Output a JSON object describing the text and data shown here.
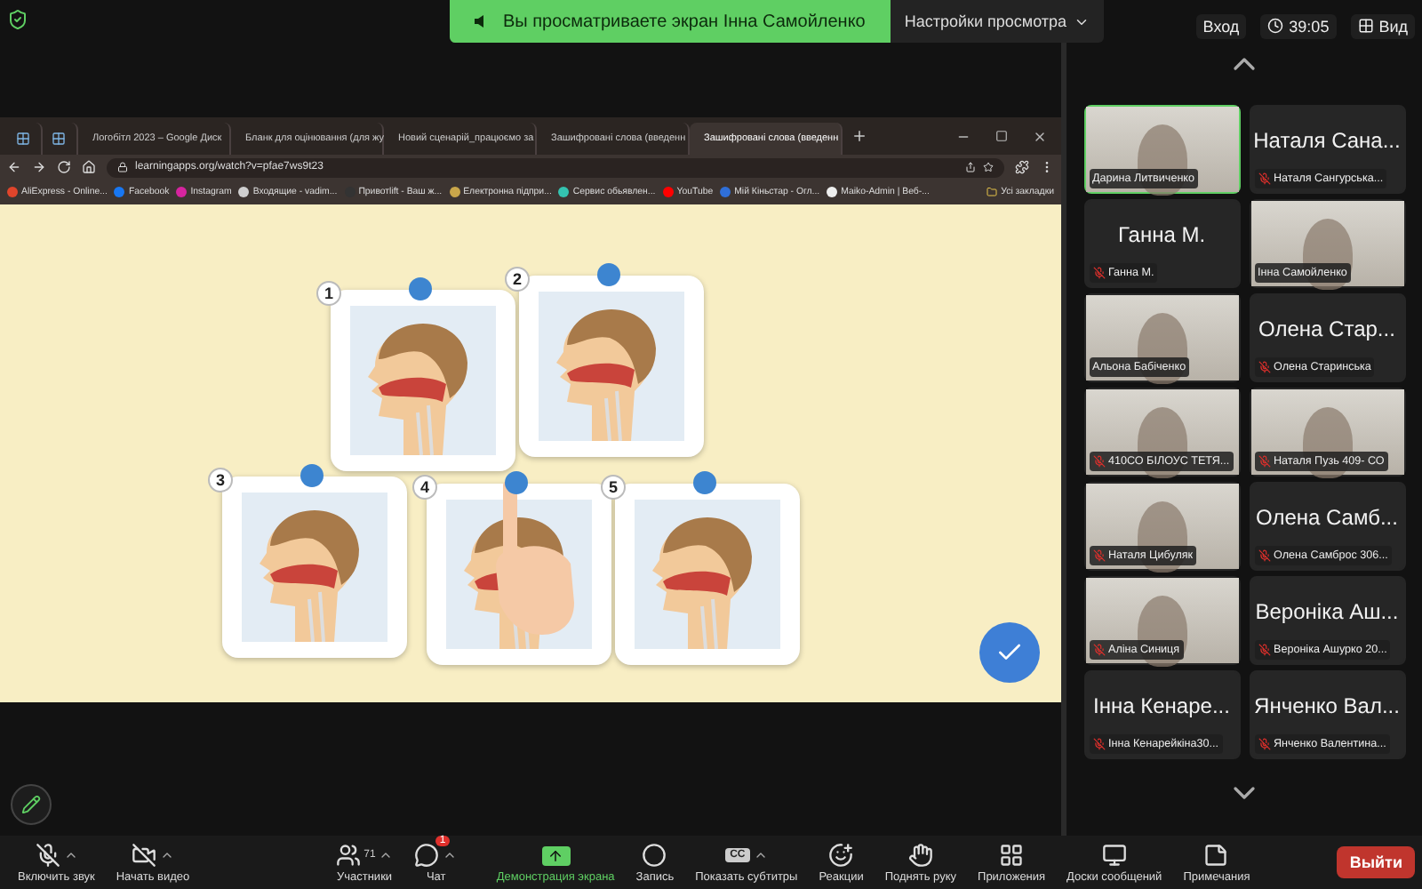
{
  "banner": {
    "text": "Вы просматриваете экран Інна Самойленко",
    "settings": "Настройки просмотра"
  },
  "top_right": {
    "sign_in": "Вход",
    "timer": "39:05",
    "view": "Вид"
  },
  "browser": {
    "tabs": [
      {
        "kind": "pinned",
        "selected": false
      },
      {
        "kind": "pinned",
        "selected": false
      },
      {
        "kind": "drive",
        "label": "Логобітл 2023 – Google Диск",
        "selected": false
      },
      {
        "kind": "doc",
        "label": "Бланк для оцінювання (для жу",
        "selected": false
      },
      {
        "kind": "doc",
        "label": "Новий сценарій_працюємо за",
        "selected": false
      },
      {
        "kind": "app",
        "label": "Зашифровані слова (введенн",
        "selected": false
      },
      {
        "kind": "app",
        "label": "Зашифровані слова (введенн",
        "selected": true
      }
    ],
    "url": "learningapps.org/watch?v=pfae7ws9t23",
    "bookmarks": [
      {
        "label": "AliExpress - Online...",
        "color": "#e0452b"
      },
      {
        "label": "Facebook",
        "color": "#1877f2"
      },
      {
        "label": "Instagram",
        "color": "#d6249f"
      },
      {
        "label": "Входящие - vadim...",
        "color": "#cfcfcf"
      },
      {
        "label": "Привотlift - Ваш ж...",
        "color": "#333333"
      },
      {
        "label": "Електронна підпри...",
        "color": "#c9a64a"
      },
      {
        "label": "Сервис обьявлен...",
        "color": "#34c3b0"
      },
      {
        "label": "YouTube",
        "color": "#ff0000"
      },
      {
        "label": "Мій Кіньстар - Огл...",
        "color": "#2f6fd8"
      },
      {
        "label": "Maiko-Admin | Веб-...",
        "color": "#eeeeee"
      }
    ],
    "all_bookmarks": "Усі закладки",
    "cards": [
      {
        "number": "1"
      },
      {
        "number": "2"
      },
      {
        "number": "3"
      },
      {
        "number": "4"
      },
      {
        "number": "5"
      }
    ]
  },
  "participants": [
    {
      "kind": "video",
      "label": "Дарина Литвиченко",
      "muted": false,
      "active": true
    },
    {
      "kind": "name",
      "name": "Наталя Сана...",
      "label": "Наталя Сангурська...",
      "muted": true,
      "active": false
    },
    {
      "kind": "name",
      "name": "Ганна М.",
      "label": "Ганна М.",
      "muted": true,
      "active": false
    },
    {
      "kind": "video",
      "label": "Інна Самойленко",
      "muted": false,
      "active": false
    },
    {
      "kind": "video",
      "label": "Альона Бабіченко",
      "muted": false,
      "active": false
    },
    {
      "kind": "name",
      "name": "Олена Стар...",
      "label": "Олена Старинська",
      "muted": true,
      "active": false
    },
    {
      "kind": "video",
      "label": "410СО БІЛОУС ТЕТЯ...",
      "muted": true,
      "active": false
    },
    {
      "kind": "video",
      "label": "Наталя Пузь 409- СО",
      "muted": true,
      "active": false
    },
    {
      "kind": "video",
      "label": "Наталя Цибуляк",
      "muted": true,
      "active": false
    },
    {
      "kind": "name",
      "name": "Олена Самб...",
      "label": "Олена Самброс 306...",
      "muted": true,
      "active": false
    },
    {
      "kind": "video",
      "label": "Аліна Синиця",
      "muted": true,
      "active": false
    },
    {
      "kind": "name",
      "name": "Вероніка Аш...",
      "label": "Вероніка Ашурко 20...",
      "muted": true,
      "active": false
    },
    {
      "kind": "name",
      "name": "Інна Кенаре...",
      "label": "Інна Кенарейкіна30...",
      "muted": true,
      "active": false
    },
    {
      "kind": "name",
      "name": "Янченко Вал...",
      "label": "Янченко Валентина...",
      "muted": true,
      "active": false
    }
  ],
  "toolbar": [
    {
      "label": "Включить звук",
      "has_menu": true,
      "highlight": false
    },
    {
      "label": "Начать видео",
      "has_menu": true,
      "highlight": false
    },
    {
      "label": "Участники",
      "count": "71",
      "has_menu": true,
      "highlight": false
    },
    {
      "label": "Чат",
      "badge": "1",
      "has_menu": true,
      "highlight": false
    },
    {
      "label": "Демонстрация экрана",
      "has_menu": false,
      "highlight": true
    },
    {
      "label": "Запись",
      "has_menu": false,
      "highlight": false
    },
    {
      "label": "Показать субтитры",
      "glyph": "CC",
      "has_menu": true,
      "highlight": false
    },
    {
      "label": "Реакции",
      "has_menu": false,
      "highlight": false
    },
    {
      "label": "Поднять руку",
      "has_menu": false,
      "highlight": false
    },
    {
      "label": "Приложения",
      "has_menu": false,
      "highlight": false
    },
    {
      "label": "Доски сообщений",
      "has_menu": false,
      "highlight": false
    },
    {
      "label": "Примечания",
      "has_menu": false,
      "highlight": false
    }
  ],
  "leave": "Выйти"
}
